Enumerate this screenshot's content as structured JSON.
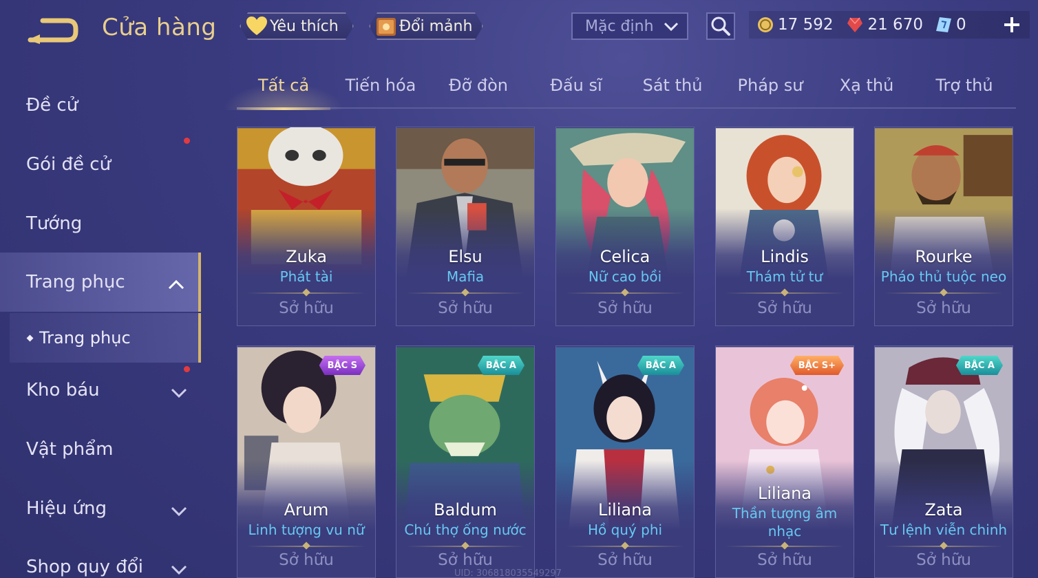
{
  "header": {
    "title": "Cửa hàng",
    "favorite_label": "Yêu thích",
    "shard_label": "Đổi mảnh",
    "sort_selected": "Mặc định",
    "currency": {
      "gold": "17 592",
      "gems": "21 670",
      "vouchers": "0"
    }
  },
  "sidebar": {
    "items": [
      {
        "label": "Đề cử"
      },
      {
        "label": "Gói đề cử"
      },
      {
        "label": "Tướng"
      },
      {
        "label": "Trang phục"
      },
      {
        "label": "Kho báu"
      },
      {
        "label": "Vật phẩm"
      },
      {
        "label": "Hiệu ứng"
      },
      {
        "label": "Shop quy đổi"
      }
    ],
    "sub_item": "Trang phục"
  },
  "tabs": [
    "Tất cả",
    "Tiến hóa",
    "Đỡ đòn",
    "Đấu sĩ",
    "Sát thủ",
    "Pháp sư",
    "Xạ thủ",
    "Trợ thủ"
  ],
  "cards": [
    {
      "hero": "Zuka",
      "skin": "Phát tài",
      "status": "Sở hữu"
    },
    {
      "hero": "Elsu",
      "skin": "Mafia",
      "status": "Sở hữu"
    },
    {
      "hero": "Celica",
      "skin": "Nữ cao bồi",
      "status": "Sở hữu"
    },
    {
      "hero": "Lindis",
      "skin": "Thám tử tư",
      "status": "Sở hữu"
    },
    {
      "hero": "Rourke",
      "skin": "Pháo thủ tuộc neo",
      "status": "Sở hữu"
    },
    {
      "hero": "Arum",
      "skin": "Linh tượng vu nữ",
      "status": "Sở hữu",
      "badge": "BẬC S"
    },
    {
      "hero": "Baldum",
      "skin": "Chú thợ ống nước",
      "status": "Sở hữu",
      "badge": "BẬC A"
    },
    {
      "hero": "Liliana",
      "skin": "Hồ quý phi",
      "status": "Sở hữu",
      "badge": "BẬC A"
    },
    {
      "hero": "Liliana",
      "skin_line1": "Thần tượng âm",
      "skin_line2": "nhạc",
      "status": "Sở hữu",
      "badge": "BẬC S+"
    },
    {
      "hero": "Zata",
      "skin": "Tư lệnh viễn chinh",
      "status": "Sở hữu",
      "badge": "BẬC A"
    }
  ],
  "footer": {
    "uid": "UID: 306818035549297"
  },
  "colors": {
    "accent_gold": "#e9cf8c",
    "skin_name": "#66c9f2",
    "notification_dot": "#e33a3f",
    "badge_s": "#a24ee0",
    "badge_a": "#2bb3b3",
    "badge_s_plus": "#f07a3e"
  },
  "icons": [
    "back-arrow-icon",
    "heart-icon",
    "chest-icon",
    "chevron-down-icon",
    "search-icon",
    "gold-coin-icon",
    "gem-icon",
    "voucher-icon",
    "plus-icon",
    "chevron-up-icon"
  ]
}
